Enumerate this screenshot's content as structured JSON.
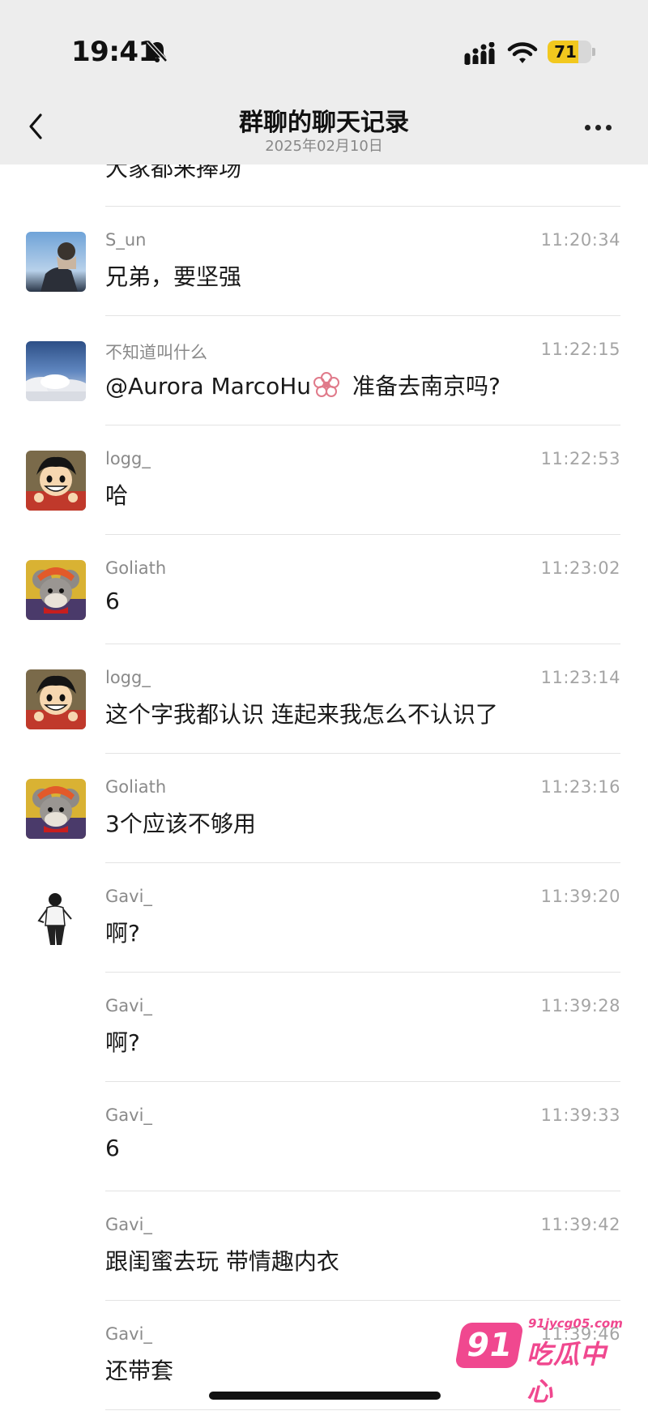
{
  "status_bar": {
    "time": "19:41",
    "battery": "71",
    "battery_level": 0.71
  },
  "header": {
    "title": "群聊的聊天记录",
    "date": "2025年02月10日"
  },
  "partial_text": "大家都来捧场",
  "messages": [
    {
      "name": "S_un",
      "time": "11:20:34",
      "text": "兄弟，要坚强",
      "avatar": "sky-photo-avatar"
    },
    {
      "name": "不知道叫什么",
      "time": "11:22:15",
      "text_before": "@Aurora MarcoHu",
      "text_after": " 准备去南京吗?",
      "avatar": "clouds-avatar"
    },
    {
      "name": "logg_",
      "time": "11:22:53",
      "text": "哈",
      "avatar": "anime-pirate-avatar"
    },
    {
      "name": "Goliath",
      "time": "11:23:02",
      "text": "6",
      "avatar": "cartoon-mouse-avatar"
    },
    {
      "name": "logg_",
      "time": "11:23:14",
      "text": "这个字我都认识 连起来我怎么不认识了",
      "avatar": "anime-pirate-avatar"
    },
    {
      "name": "Goliath",
      "time": "11:23:16",
      "text": "3个应该不够用",
      "avatar": "cartoon-mouse-avatar"
    },
    {
      "name": "Gavi_",
      "time": "11:39:20",
      "text": "啊?",
      "avatar": "sketch-person-avatar"
    },
    {
      "name": "Gavi_",
      "time": "11:39:28",
      "text": "啊?"
    },
    {
      "name": "Gavi_",
      "time": "11:39:33",
      "text": "6"
    },
    {
      "name": "Gavi_",
      "time": "11:39:42",
      "text": "跟闺蜜去玩 带情趣内衣"
    },
    {
      "name": "Gavi_",
      "time": "11:39:46",
      "text": "还带套"
    }
  ],
  "watermark": {
    "badge": "91",
    "url": "91jycg05.com",
    "name": "吃瓜中心"
  },
  "colors": {
    "header_bg": "#ededed",
    "battery": "#f2c81e",
    "watermark": "#f0488f"
  }
}
